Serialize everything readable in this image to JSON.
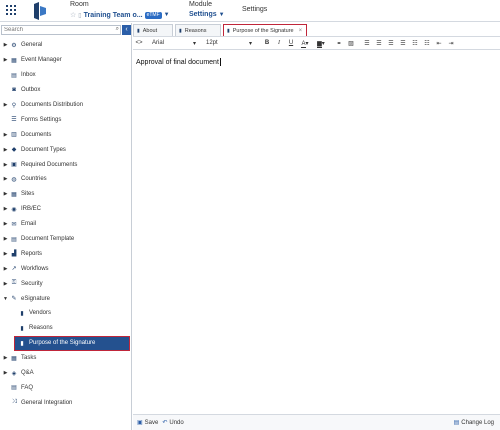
{
  "header": {
    "room_label": "Room",
    "room_name": "Training Team o...",
    "room_badge": "eTMF",
    "module_label": "Module",
    "module_name": "Settings",
    "page_title": "Settings"
  },
  "sidebar": {
    "search_placeholder": "Search",
    "items": [
      {
        "label": "General",
        "icon": "gear-icon"
      },
      {
        "label": "Event Manager",
        "icon": "calendar-icon"
      },
      {
        "label": "Inbox",
        "icon": "inbox-icon"
      },
      {
        "label": "Outbox",
        "icon": "outbox-icon"
      },
      {
        "label": "Documents Distribution",
        "icon": "share-icon"
      },
      {
        "label": "Forms Settings",
        "icon": "form-icon"
      },
      {
        "label": "Documents",
        "icon": "document-icon"
      },
      {
        "label": "Document Types",
        "icon": "tag-icon"
      },
      {
        "label": "Required Documents",
        "icon": "required-doc-icon"
      },
      {
        "label": "Countries",
        "icon": "globe-icon"
      },
      {
        "label": "Sites",
        "icon": "site-icon"
      },
      {
        "label": "IRB/EC",
        "icon": "irb-icon"
      },
      {
        "label": "Email",
        "icon": "email-icon"
      },
      {
        "label": "Document Template",
        "icon": "template-icon"
      },
      {
        "label": "Reports",
        "icon": "chart-icon"
      },
      {
        "label": "Workflows",
        "icon": "workflow-icon"
      },
      {
        "label": "Security",
        "icon": "lock-icon"
      },
      {
        "label": "eSignature",
        "icon": "pen-icon"
      },
      {
        "label": "Vendors",
        "icon": "file-icon"
      },
      {
        "label": "Reasons",
        "icon": "file-icon"
      },
      {
        "label": "Purpose of the Signature",
        "icon": "file-icon"
      },
      {
        "label": "Tasks",
        "icon": "tasks-icon"
      },
      {
        "label": "Q&A",
        "icon": "qa-icon"
      },
      {
        "label": "FAQ",
        "icon": "faq-icon"
      },
      {
        "label": "General Integration",
        "icon": "integration-icon"
      }
    ]
  },
  "tabs": [
    {
      "label": "About"
    },
    {
      "label": "Reasons"
    },
    {
      "label": "Purpose of the Signature"
    }
  ],
  "toolbar": {
    "font_family": "Arial",
    "font_size": "12pt"
  },
  "editor": {
    "content": "Approval of final document"
  },
  "footer": {
    "save_label": "Save",
    "undo_label": "Undo",
    "changelog_label": "Change Log"
  },
  "colors": {
    "accent": "#24518f",
    "highlight_border": "#c0263a"
  }
}
